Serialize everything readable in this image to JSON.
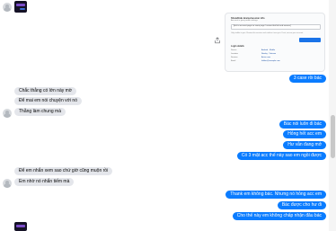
{
  "card": {
    "title": "Show/hide device/session info",
    "subtitle": "Account in your profile settings",
    "field_text": "[link to account page on some page / review that link and remove]",
    "note": "Only visible to you. Review this session and confirm it was you. If not, secure your account.",
    "section": "Login details",
    "rows": [
      {
        "label": "Device",
        "value": "Android · Mobile"
      },
      {
        "label": "Location",
        "value": "Nearby · Vietnam"
      },
      {
        "label": "Session",
        "value": "Active now"
      },
      {
        "label": "Email",
        "value": "hidden@example.com"
      }
    ]
  },
  "messages_out_top": [
    {
      "text": "3 case rồi bác"
    }
  ],
  "messages_in_1": [
    {
      "text": "Chắc thằng có lớn này mờ"
    },
    {
      "text": "Để mai em nói chuyện với nó"
    },
    {
      "text": "Thằng làm chung mà"
    }
  ],
  "messages_out_mid": [
    {
      "text": "Bác nói luôn đi bác"
    },
    {
      "text": "Hỏng hết acc em"
    },
    {
      "text": "Hư vẫn đang mở"
    },
    {
      "text": "Có 3 mặt acc thế này sao em ngồi được"
    }
  ],
  "messages_in_2": [
    {
      "text": "Để em nhắn xem sao chứ giờ cũng muộn rồi"
    },
    {
      "text": "Em nhờ nó nhắn tiếm mà"
    }
  ],
  "messages_out_bottom": [
    {
      "text": "Thank em không bác. Nhưng nó hỏng acc em"
    },
    {
      "text": "Bác được cho hư đi"
    },
    {
      "text": "Cho thế này em không chấp nhận đâu bác"
    }
  ]
}
